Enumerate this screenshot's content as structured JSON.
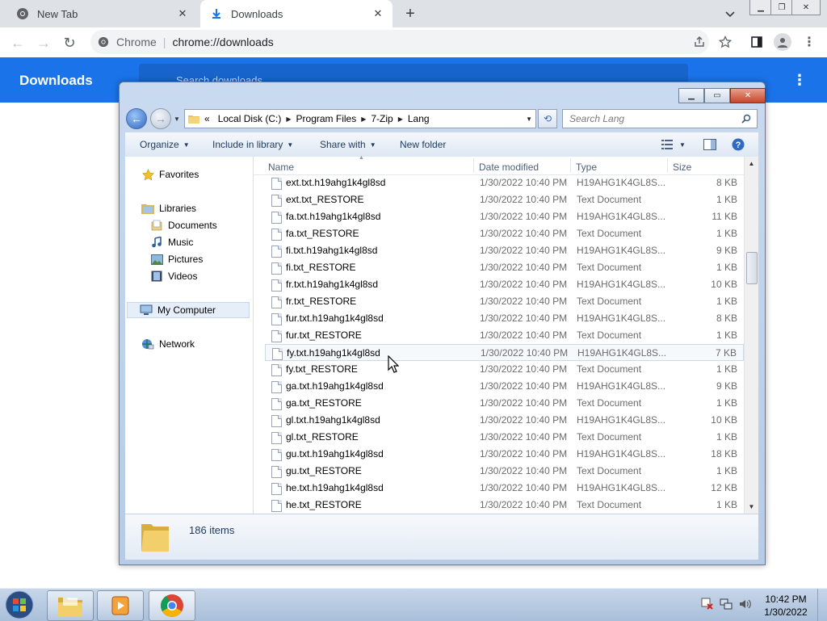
{
  "chrome": {
    "tabs": [
      {
        "label": "New Tab",
        "active": false
      },
      {
        "label": "Downloads",
        "active": true
      }
    ],
    "omnibox": {
      "origin": "Chrome",
      "url": "chrome://downloads"
    }
  },
  "downloads_page": {
    "title": "Downloads",
    "search_placeholder": "Search downloads"
  },
  "explorer": {
    "breadcrumb": [
      "«",
      "Local Disk (C:)",
      "Program Files",
      "7-Zip",
      "Lang"
    ],
    "search_placeholder": "Search Lang",
    "commands": {
      "organize": "Organize",
      "include": "Include in library",
      "share": "Share with",
      "newfolder": "New folder"
    },
    "nav": {
      "favorites": "Favorites",
      "libraries": "Libraries",
      "documents": "Documents",
      "music": "Music",
      "pictures": "Pictures",
      "videos": "Videos",
      "computer": "My Computer",
      "network": "Network"
    },
    "columns": {
      "name": "Name",
      "date": "Date modified",
      "type": "Type",
      "size": "Size"
    },
    "files": [
      {
        "name": "ext.txt.h19ahg1k4gl8sd",
        "date": "1/30/2022 10:40 PM",
        "type": "H19AHG1K4GL8S...",
        "size": "8 KB"
      },
      {
        "name": "ext.txt_RESTORE",
        "date": "1/30/2022 10:40 PM",
        "type": "Text Document",
        "size": "1 KB"
      },
      {
        "name": "fa.txt.h19ahg1k4gl8sd",
        "date": "1/30/2022 10:40 PM",
        "type": "H19AHG1K4GL8S...",
        "size": "11 KB"
      },
      {
        "name": "fa.txt_RESTORE",
        "date": "1/30/2022 10:40 PM",
        "type": "Text Document",
        "size": "1 KB"
      },
      {
        "name": "fi.txt.h19ahg1k4gl8sd",
        "date": "1/30/2022 10:40 PM",
        "type": "H19AHG1K4GL8S...",
        "size": "9 KB"
      },
      {
        "name": "fi.txt_RESTORE",
        "date": "1/30/2022 10:40 PM",
        "type": "Text Document",
        "size": "1 KB"
      },
      {
        "name": "fr.txt.h19ahg1k4gl8sd",
        "date": "1/30/2022 10:40 PM",
        "type": "H19AHG1K4GL8S...",
        "size": "10 KB"
      },
      {
        "name": "fr.txt_RESTORE",
        "date": "1/30/2022 10:40 PM",
        "type": "Text Document",
        "size": "1 KB"
      },
      {
        "name": "fur.txt.h19ahg1k4gl8sd",
        "date": "1/30/2022 10:40 PM",
        "type": "H19AHG1K4GL8S...",
        "size": "8 KB"
      },
      {
        "name": "fur.txt_RESTORE",
        "date": "1/30/2022 10:40 PM",
        "type": "Text Document",
        "size": "1 KB"
      },
      {
        "name": "fy.txt.h19ahg1k4gl8sd",
        "date": "1/30/2022 10:40 PM",
        "type": "H19AHG1K4GL8S...",
        "size": "7 KB"
      },
      {
        "name": "fy.txt_RESTORE",
        "date": "1/30/2022 10:40 PM",
        "type": "Text Document",
        "size": "1 KB"
      },
      {
        "name": "ga.txt.h19ahg1k4gl8sd",
        "date": "1/30/2022 10:40 PM",
        "type": "H19AHG1K4GL8S...",
        "size": "9 KB"
      },
      {
        "name": "ga.txt_RESTORE",
        "date": "1/30/2022 10:40 PM",
        "type": "Text Document",
        "size": "1 KB"
      },
      {
        "name": "gl.txt.h19ahg1k4gl8sd",
        "date": "1/30/2022 10:40 PM",
        "type": "H19AHG1K4GL8S...",
        "size": "10 KB"
      },
      {
        "name": "gl.txt_RESTORE",
        "date": "1/30/2022 10:40 PM",
        "type": "Text Document",
        "size": "1 KB"
      },
      {
        "name": "gu.txt.h19ahg1k4gl8sd",
        "date": "1/30/2022 10:40 PM",
        "type": "H19AHG1K4GL8S...",
        "size": "18 KB"
      },
      {
        "name": "gu.txt_RESTORE",
        "date": "1/30/2022 10:40 PM",
        "type": "Text Document",
        "size": "1 KB"
      },
      {
        "name": "he.txt.h19ahg1k4gl8sd",
        "date": "1/30/2022 10:40 PM",
        "type": "H19AHG1K4GL8S...",
        "size": "12 KB"
      },
      {
        "name": "he.txt_RESTORE",
        "date": "1/30/2022 10:40 PM",
        "type": "Text Document",
        "size": "1 KB"
      }
    ],
    "item_count": "186 items"
  },
  "taskbar": {
    "time": "10:42 PM",
    "date": "1/30/2022"
  },
  "colors": {
    "chrome_blue": "#1a73e8",
    "tabstrip": "#dee1e6"
  },
  "icons": [
    "chrome-icon",
    "download-icon",
    "close-icon",
    "plus-icon",
    "chevron-down-icon",
    "back-arrow-icon",
    "forward-arrow-icon",
    "reload-icon",
    "share-icon",
    "star-icon",
    "side-panel-icon",
    "profile-icon",
    "more-vert-icon",
    "search-icon",
    "folder-icon",
    "file-icon",
    "windows-start-icon",
    "explorer-icon",
    "media-player-icon",
    "volume-icon",
    "network-tray-icon",
    "action-center-icon"
  ]
}
